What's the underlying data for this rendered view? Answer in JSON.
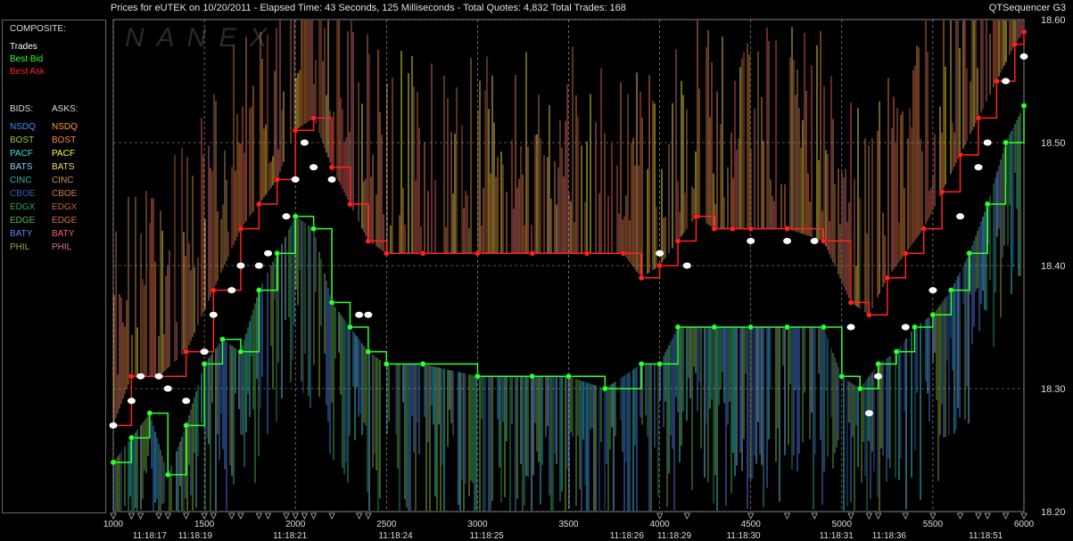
{
  "header": {
    "title": "Prices for  eUTEK  on  10/20/2011  -  Elapsed Time: 43 Seconds, 125 Milliseconds  -  Total Quotes: 4,832  Total Trades: 168",
    "product": "QTSequencer G3"
  },
  "legend": {
    "composite_label": "COMPOSITE:",
    "composite": [
      {
        "label": "Trades",
        "color": "#ffffff"
      },
      {
        "label": "Best Bid",
        "color": "#33ff33"
      },
      {
        "label": "Best Ask",
        "color": "#ff2222"
      }
    ],
    "bids_label": "BIDS:",
    "asks_label": "ASKS:",
    "exchanges": [
      {
        "bid": "NSDQ",
        "ask": "NSDQ",
        "bid_color": "#4a8cff",
        "ask_color": "#ff9933"
      },
      {
        "bid": "BOST",
        "ask": "BOST",
        "bid_color": "#9acd32",
        "ask_color": "#ff8a50"
      },
      {
        "bid": "PACF",
        "ask": "PACF",
        "bid_color": "#33e6e6",
        "ask_color": "#ffff33"
      },
      {
        "bid": "BATS",
        "ask": "BATS",
        "bid_color": "#8fd0ff",
        "ask_color": "#ffd766"
      },
      {
        "bid": "CINC",
        "ask": "CINC",
        "bid_color": "#3fb0b0",
        "ask_color": "#cc9955"
      },
      {
        "bid": "CBOE",
        "ask": "CBOE",
        "bid_color": "#3060c0",
        "ask_color": "#d08040"
      },
      {
        "bid": "EDGX",
        "ask": "EDGX",
        "bid_color": "#30a060",
        "ask_color": "#c06040"
      },
      {
        "bid": "EDGE",
        "ask": "EDGE",
        "bid_color": "#50c050",
        "ask_color": "#d07050"
      },
      {
        "bid": "BATY",
        "ask": "BATY",
        "bid_color": "#6080ff",
        "ask_color": "#ff6060"
      },
      {
        "bid": "PHIL",
        "ask": "PHIL",
        "bid_color": "#90b040",
        "ask_color": "#e07090"
      }
    ]
  },
  "watermark": "NANEX",
  "chart_data": {
    "type": "line",
    "xlabel": "",
    "ylabel": "",
    "xlim": [
      1000,
      6000
    ],
    "ylim": [
      18.2,
      18.6
    ],
    "grid": true,
    "y_ticks": [
      "18.60",
      "18.50",
      "18.40",
      "18.30",
      "18.20"
    ],
    "x_ticks": [
      "1000",
      "1500",
      "2000",
      "2500",
      "3000",
      "3500",
      "4000",
      "4500",
      "5000",
      "5500",
      "6000"
    ],
    "time_labels": [
      {
        "x": 1200,
        "label": "11:18:17"
      },
      {
        "x": 1450,
        "label": "11:18:19"
      },
      {
        "x": 1970,
        "label": "11:18:21"
      },
      {
        "x": 2550,
        "label": "11:18:24"
      },
      {
        "x": 3050,
        "label": "11:18:25"
      },
      {
        "x": 3820,
        "label": "11:18:26"
      },
      {
        "x": 4080,
        "label": "11:18:29"
      },
      {
        "x": 4460,
        "label": "11:18:30"
      },
      {
        "x": 4970,
        "label": "11:18:31"
      },
      {
        "x": 5260,
        "label": "11:18:36"
      },
      {
        "x": 5790,
        "label": "11:18:51"
      }
    ],
    "series": [
      {
        "name": "Best Ask",
        "color": "#ff2222",
        "x": [
          1000,
          1100,
          1250,
          1400,
          1550,
          1700,
          1800,
          1900,
          2000,
          2100,
          2200,
          2300,
          2400,
          2500,
          2700,
          3000,
          3300,
          3600,
          3800,
          3900,
          4000,
          4100,
          4200,
          4300,
          4400,
          4500,
          4700,
          4900,
          5050,
          5150,
          5250,
          5350,
          5450,
          5550,
          5650,
          5750,
          5850,
          5950,
          6000
        ],
        "y": [
          18.27,
          18.31,
          18.31,
          18.33,
          18.38,
          18.43,
          18.45,
          18.47,
          18.51,
          18.52,
          18.48,
          18.45,
          18.42,
          18.41,
          18.41,
          18.41,
          18.41,
          18.41,
          18.41,
          18.39,
          18.4,
          18.42,
          18.44,
          18.43,
          18.43,
          18.43,
          18.43,
          18.42,
          18.37,
          18.36,
          18.39,
          18.41,
          18.43,
          18.46,
          18.49,
          18.52,
          18.55,
          18.58,
          18.59
        ]
      },
      {
        "name": "Best Bid",
        "color": "#33ff33",
        "x": [
          1000,
          1100,
          1200,
          1300,
          1400,
          1500,
          1600,
          1700,
          1800,
          1900,
          2000,
          2100,
          2200,
          2300,
          2400,
          2500,
          2700,
          3000,
          3300,
          3500,
          3700,
          3900,
          4000,
          4100,
          4300,
          4500,
          4700,
          4900,
          5000,
          5100,
          5200,
          5300,
          5400,
          5500,
          5600,
          5700,
          5800,
          5900,
          6000
        ],
        "y": [
          18.24,
          18.26,
          18.28,
          18.23,
          18.27,
          18.32,
          18.34,
          18.33,
          18.38,
          18.41,
          18.44,
          18.43,
          18.37,
          18.35,
          18.33,
          18.32,
          18.32,
          18.31,
          18.31,
          18.31,
          18.3,
          18.32,
          18.32,
          18.35,
          18.35,
          18.35,
          18.35,
          18.35,
          18.31,
          18.3,
          18.32,
          18.33,
          18.35,
          18.36,
          18.38,
          18.41,
          18.45,
          18.5,
          18.53
        ]
      },
      {
        "name": "Trades",
        "color": "#ffffff",
        "x": [
          1000,
          1100,
          1150,
          1250,
          1300,
          1400,
          1500,
          1550,
          1650,
          1700,
          1800,
          1850,
          1950,
          2000,
          2050,
          2100,
          2200,
          2350,
          2400,
          4000,
          4150,
          4500,
          4700,
          4850,
          5050,
          5150,
          5200,
          5350,
          5500,
          5650,
          5750,
          5800,
          5900,
          6000
        ],
        "y": [
          18.27,
          18.29,
          18.31,
          18.31,
          18.3,
          18.29,
          18.33,
          18.36,
          18.38,
          18.4,
          18.4,
          18.41,
          18.44,
          18.47,
          18.5,
          18.48,
          18.47,
          18.36,
          18.36,
          18.41,
          18.4,
          18.42,
          18.42,
          18.42,
          18.35,
          18.28,
          18.31,
          18.35,
          18.38,
          18.44,
          18.48,
          18.5,
          18.55,
          18.57
        ]
      }
    ]
  }
}
